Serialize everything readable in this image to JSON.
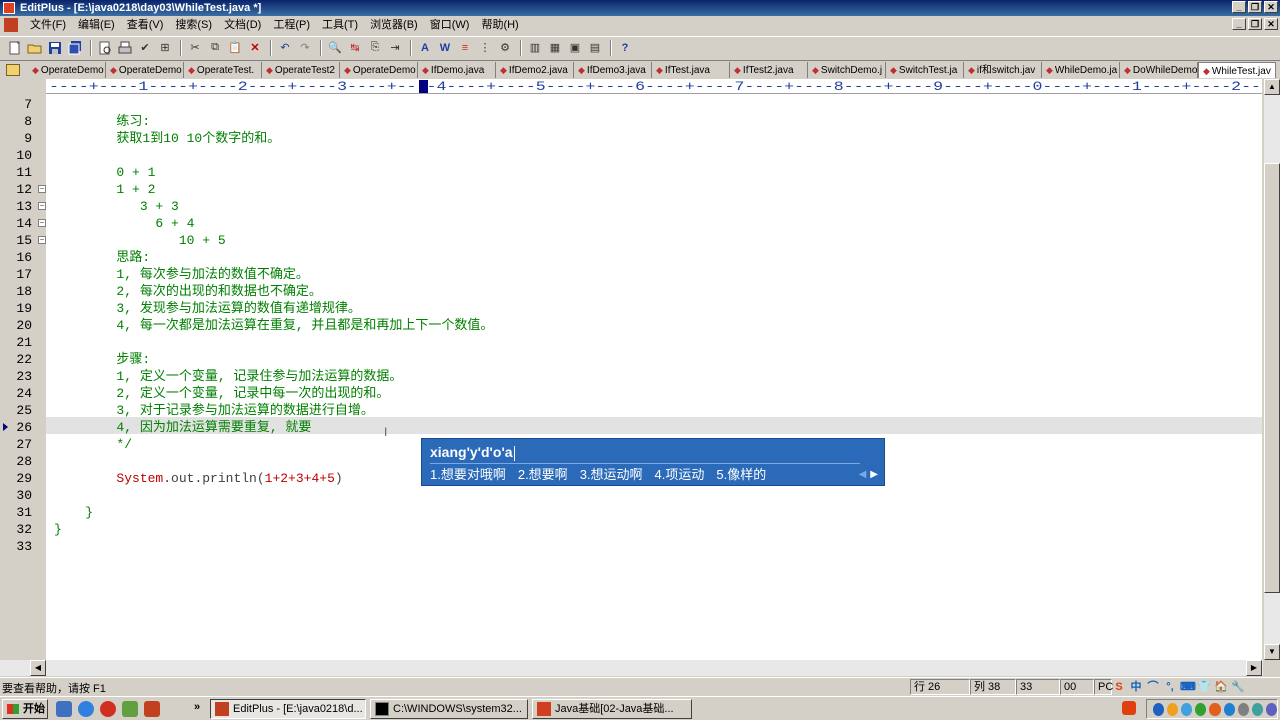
{
  "window": {
    "title": "EditPlus - [E:\\java0218\\day03\\WhileTest.java *]",
    "controls": [
      "_",
      "❐",
      "✕"
    ]
  },
  "menubar": {
    "items": [
      "文件(F)",
      "编辑(E)",
      "查看(V)",
      "搜索(S)",
      "文档(D)",
      "工程(P)",
      "工具(T)",
      "浏览器(B)",
      "窗口(W)",
      "帮助(H)"
    ]
  },
  "tabs": [
    {
      "label": "OperateDemo"
    },
    {
      "label": "OperateDemo"
    },
    {
      "label": "OperateTest."
    },
    {
      "label": "OperateTest2"
    },
    {
      "label": "OperateDemo"
    },
    {
      "label": "IfDemo.java"
    },
    {
      "label": "IfDemo2.java"
    },
    {
      "label": "IfDemo3.java"
    },
    {
      "label": "IfTest.java"
    },
    {
      "label": "IfTest2.java"
    },
    {
      "label": "SwitchDemo.j"
    },
    {
      "label": "SwitchTest.ja"
    },
    {
      "label": "if和switch.jav"
    },
    {
      "label": "WhileDemo.ja"
    },
    {
      "label": "DoWhileDemo"
    },
    {
      "label": "WhileTest.jav"
    }
  ],
  "ruler": {
    "text": "----+----1----+----2----+----3----+----4----+----5----+----6----+----7----+----8----+----9----+----0----+----1----+----2--"
  },
  "editor": {
    "lines": [
      {
        "num": "7",
        "text": ""
      },
      {
        "num": "8",
        "text": "        练习:"
      },
      {
        "num": "9",
        "text": "        获取1到10 10个数字的和。"
      },
      {
        "num": "10",
        "text": ""
      },
      {
        "num": "11",
        "text": "        0 + 1"
      },
      {
        "num": "12",
        "text": "        1 + 2"
      },
      {
        "num": "13",
        "text": "           3 + 3"
      },
      {
        "num": "14",
        "text": "             6 + 4"
      },
      {
        "num": "15",
        "text": "                10 + 5"
      },
      {
        "num": "16",
        "text": "        思路:"
      },
      {
        "num": "17",
        "text": "        1, 每次参与加法的数值不确定。"
      },
      {
        "num": "18",
        "text": "        2, 每次的出现的和数据也不确定。"
      },
      {
        "num": "19",
        "text": "        3, 发现参与加法运算的数值有递增规律。"
      },
      {
        "num": "20",
        "text": "        4, 每一次都是加法运算在重复, 并且都是和再加上下一个数值。"
      },
      {
        "num": "21",
        "text": ""
      },
      {
        "num": "22",
        "text": "        步骤:"
      },
      {
        "num": "23",
        "text": "        1, 定义一个变量, 记录住参与加法运算的数据。"
      },
      {
        "num": "24",
        "text": "        2, 定义一个变量, 记录中每一次的出现的和。"
      },
      {
        "num": "25",
        "text": "        3, 对于记录参与加法运算的数据进行自增。"
      },
      {
        "num": "26",
        "text": "        4, 因为加法运算需要重复, 就要"
      },
      {
        "num": "27",
        "text": "        */"
      },
      {
        "num": "28",
        "text": ""
      },
      {
        "num": "29",
        "text": ""
      },
      {
        "num": "30",
        "text": ""
      },
      {
        "num": "31",
        "text": "    }"
      },
      {
        "num": "32",
        "text": "}"
      },
      {
        "num": "33",
        "text": ""
      }
    ],
    "line29": {
      "indent": "        ",
      "cls": "System",
      "rest": ".out.println(",
      "args": "1+2+3+4+5",
      "close": ")"
    },
    "fold_lines": [
      "12",
      "13",
      "14",
      "15"
    ],
    "current_line": "26"
  },
  "ime": {
    "input": "xiang'y'd'o'a",
    "candidates": [
      "1.想要对哦啊",
      "2.想要啊",
      "3.想运动啊",
      "4.项运动",
      "5.像样的"
    ],
    "prev_arrow": "◀",
    "next_arrow": "▶"
  },
  "status": {
    "help": "要查看帮助，请按 F1",
    "line": "行 26",
    "col": "列 38",
    "v1": "33",
    "v2": "00",
    "mode": "PC"
  },
  "ime_tray": [
    "S",
    "中",
    "⌒",
    "°,",
    "⌨",
    "👕",
    "🏠",
    "🔧"
  ],
  "taskbar": {
    "start": "开始",
    "tasks": [
      {
        "label": "EditPlus - [E:\\java0218\\d..."
      },
      {
        "label": "C:\\WINDOWS\\system32..."
      },
      {
        "label": "Java基础[02-Java基础..."
      }
    ],
    "quick_more": "»"
  },
  "colors": {
    "comment": "#008000",
    "keyword": "#c00000",
    "ime_bg": "#2a6ab8",
    "title_bg": "#0a246a"
  }
}
